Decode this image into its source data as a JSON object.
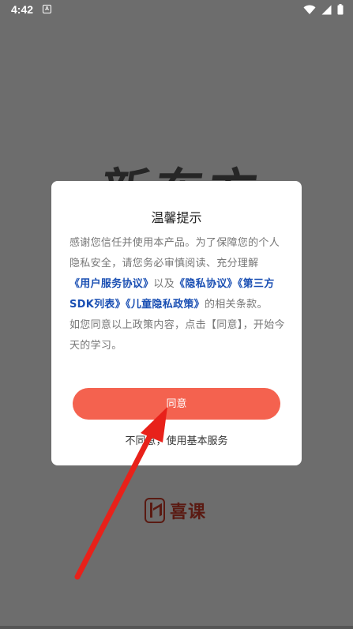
{
  "status_bar": {
    "time": "4:42",
    "notification_glyph": "A",
    "icons": [
      "wifi-icon",
      "signal-icon",
      "battery-icon"
    ]
  },
  "background": {
    "logo_text": "新东方",
    "brand_name": "喜课",
    "brand_icon": "k-logo-icon"
  },
  "dialog": {
    "title": "温馨提示",
    "body_intro": "感谢您信任并使用本产品。为了保障您的个人隐私安全，请您务必审慎阅读、充分理解",
    "link_user_agreement": "《用户服务协议》",
    "text_and": "以及",
    "link_privacy": "《隐私协议》",
    "link_sdk": "《第三方SDK列表》",
    "link_child_privacy": "《儿童隐私政策》",
    "body_terms": "的相关条款。",
    "body_consent": "如您同意以上政策内容，点击【同意】，开始今天的学习。",
    "agree_label": "同意",
    "disagree_label": "不同意，使用基本服务"
  },
  "colors": {
    "accent": "#f4624f",
    "link": "#1a4fb3",
    "overlay": "#6d6d6d",
    "annotation_arrow": "#e8211a"
  }
}
